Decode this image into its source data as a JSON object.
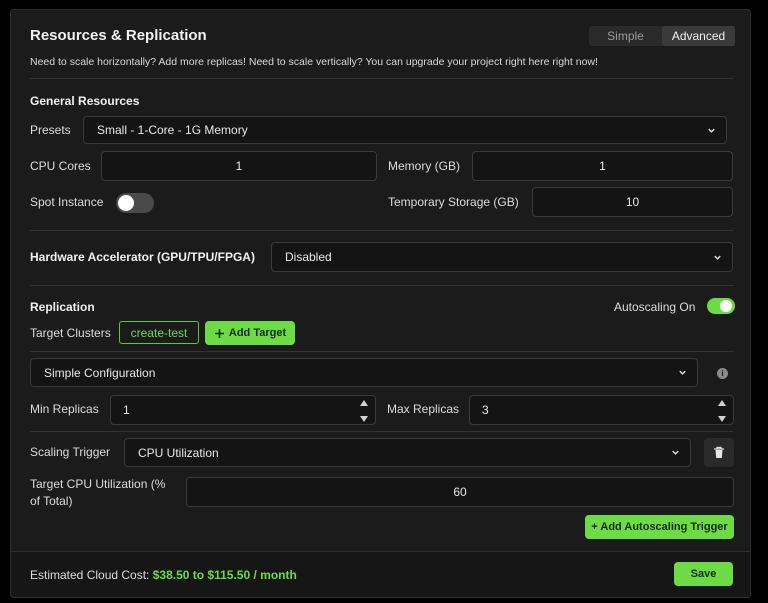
{
  "header": {
    "title": "Resources & Replication",
    "subtitle": "Need to scale horizontally? Add more replicas! Need to scale vertically? You can upgrade your project right here right now!",
    "modes": {
      "simple": "Simple",
      "advanced": "Advanced",
      "active": "Advanced"
    }
  },
  "general": {
    "heading": "General Resources",
    "presets_label": "Presets",
    "presets_value": "Small - 1-Core - 1G Memory",
    "cpu_label": "CPU Cores",
    "cpu_value": "1",
    "memory_label": "Memory (GB)",
    "memory_value": "1",
    "spot_label": "Spot Instance",
    "spot_on": false,
    "storage_label": "Temporary Storage (GB)",
    "storage_value": "10"
  },
  "accelerator": {
    "label": "Hardware Accelerator (GPU/TPU/FPGA)",
    "value": "Disabled"
  },
  "replication": {
    "heading": "Replication",
    "autoscaling_label": "Autoscaling On",
    "autoscaling_on": true,
    "target_label": "Target Clusters",
    "target_chip": "create-test",
    "add_target_label": "Add Target",
    "config_value": "Simple Configuration",
    "min_label": "Min Replicas",
    "min_value": "1",
    "max_label": "Max Replicas",
    "max_value": "3",
    "trigger_label": "Scaling Trigger",
    "trigger_value": "CPU Utilization",
    "cpu_target_label_1": "Target CPU Utilization (%",
    "cpu_target_label_2": "of Total)",
    "cpu_target_value": "60",
    "add_trigger_label": "+ Add Autoscaling Trigger"
  },
  "footer": {
    "cost_label": "Estimated Cloud Cost:",
    "cost_value": "$38.50 to $115.50 / month",
    "save_label": "Save"
  },
  "colors": {
    "accent": "#6ddc44",
    "background": "#1b1b1b",
    "field": "#141414"
  },
  "icons": [
    "chevron-down-icon",
    "plus-icon",
    "info-icon",
    "trash-icon",
    "spinner-up-icon",
    "spinner-down-icon"
  ]
}
